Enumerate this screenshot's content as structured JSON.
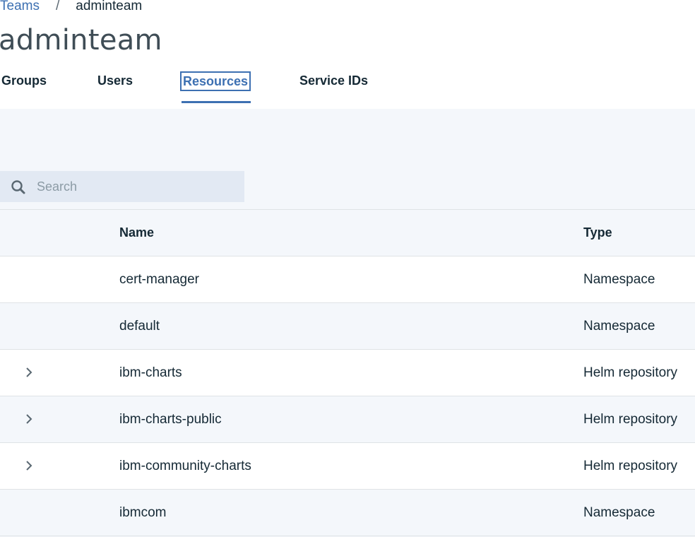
{
  "breadcrumb": {
    "parent": "Teams",
    "separator": "/",
    "current": "adminteam"
  },
  "page": {
    "title": "adminteam"
  },
  "tabs": [
    {
      "label": "Groups",
      "active": false
    },
    {
      "label": "Users",
      "active": false
    },
    {
      "label": "Resources",
      "active": true
    },
    {
      "label": "Service IDs",
      "active": false
    }
  ],
  "search": {
    "placeholder": "Search",
    "value": ""
  },
  "table": {
    "columns": {
      "name": "Name",
      "type": "Type"
    },
    "rows": [
      {
        "name": "cert-manager",
        "type": "Namespace",
        "expandable": false
      },
      {
        "name": "default",
        "type": "Namespace",
        "expandable": false
      },
      {
        "name": "ibm-charts",
        "type": "Helm repository",
        "expandable": true
      },
      {
        "name": "ibm-charts-public",
        "type": "Helm repository",
        "expandable": true
      },
      {
        "name": "ibm-community-charts",
        "type": "Helm repository",
        "expandable": true
      },
      {
        "name": "ibmcom",
        "type": "Namespace",
        "expandable": false
      }
    ]
  },
  "colors": {
    "link": "#3d70b2",
    "text": "#152935",
    "panel_bg": "#f4f7fb",
    "search_bg": "#e2e9f3",
    "border": "#dfe3e6"
  }
}
